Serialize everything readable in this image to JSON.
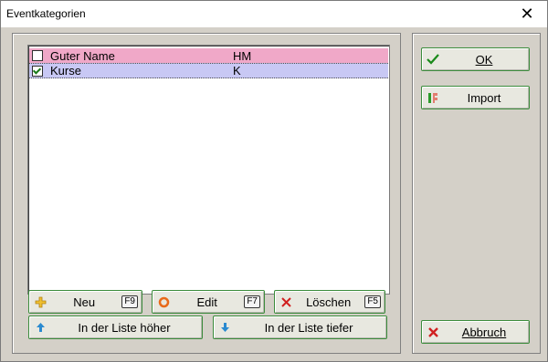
{
  "window": {
    "title": "Eventkategorien"
  },
  "list": {
    "rows": [
      {
        "checked": false,
        "name": "Guter Name",
        "code": "HM"
      },
      {
        "checked": true,
        "name": "Kurse",
        "code": "K"
      }
    ]
  },
  "buttons": {
    "neu": {
      "label": "Neu",
      "key": "F9"
    },
    "edit": {
      "label": "Edit",
      "key": "F7"
    },
    "loeschen": {
      "label": "Löschen",
      "key": "F5"
    },
    "up": {
      "label": "In der Liste höher"
    },
    "down": {
      "label": "In der Liste tiefer"
    },
    "ok": {
      "label": "OK"
    },
    "import": {
      "label": "Import"
    },
    "abbruch": {
      "label": "Abbruch"
    }
  },
  "icons": {
    "ok": "checkmark-icon",
    "import": "import-icon",
    "add": "plus-icon",
    "edit": "ring-icon",
    "delete": "x-icon",
    "up": "arrow-up-icon",
    "down": "arrow-down-icon",
    "cancel": "x-icon"
  },
  "colors": {
    "row_selected": "#f0a8c8",
    "row_focused": "#c8c8f4",
    "button_border": "#3c8c3c"
  }
}
